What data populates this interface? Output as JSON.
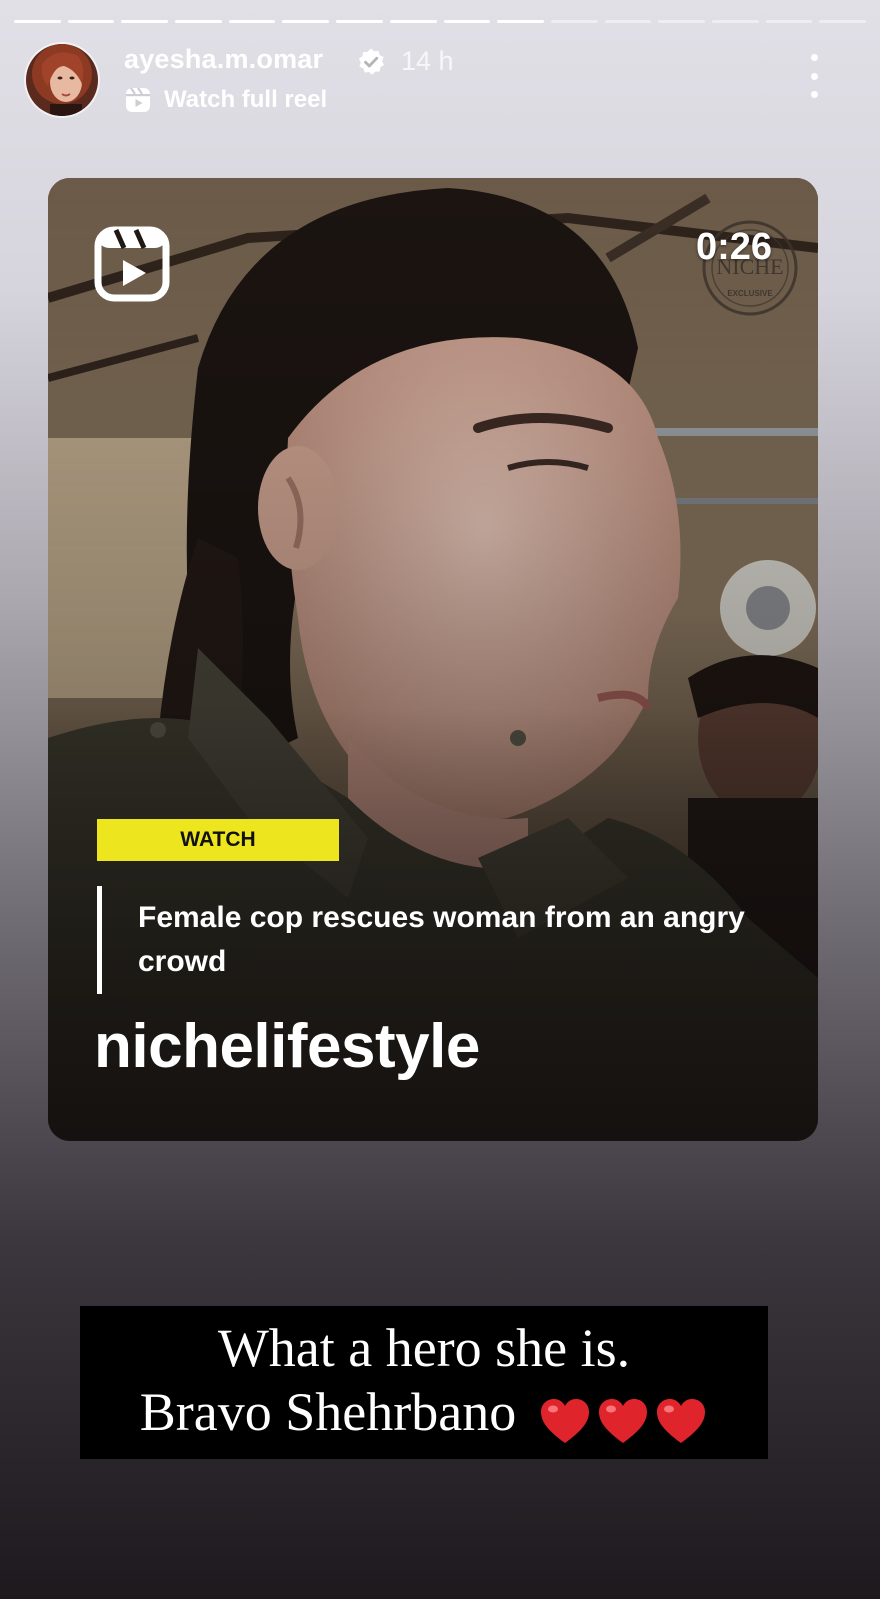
{
  "story": {
    "progress": {
      "total_segments": 16,
      "completed_segments": 10
    },
    "author": {
      "username": "ayesha.m.omar",
      "verified": true,
      "posted_ago": "14 h"
    },
    "reel_link": {
      "label": "Watch full reel",
      "icon": "reels-icon"
    },
    "more_menu": {
      "icon": "more-vertical-icon"
    }
  },
  "reel": {
    "duration": "0:26",
    "badge_icon": "reels-icon",
    "tag": "WATCH",
    "headline": "Female cop rescues woman from an angry crowd",
    "account": "nichelifestyle",
    "watermark": {
      "top": "NICHE",
      "bottom": "EXCLUSIVE"
    }
  },
  "caption": {
    "line1": "What a hero she is.",
    "line2": "Bravo Shehrbano",
    "hearts": 3
  },
  "colors": {
    "tag_yellow": "#ede51e",
    "heart_red": "#e0242c",
    "caption_bg": "#000000"
  }
}
